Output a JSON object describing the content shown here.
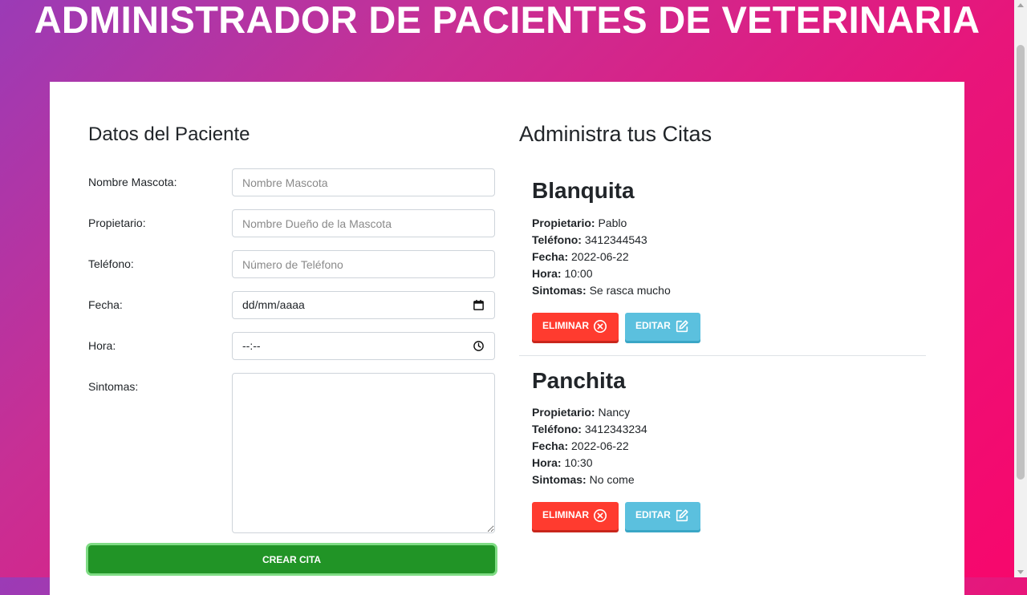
{
  "header": {
    "title": "ADMINISTRADOR DE PACIENTES DE VETERINARIA"
  },
  "form": {
    "title": "Datos del Paciente",
    "fields": [
      {
        "label": "Nombre Mascota:",
        "placeholder": "Nombre Mascota",
        "value": ""
      },
      {
        "label": "Propietario:",
        "placeholder": "Nombre Dueño de la Mascota",
        "value": ""
      },
      {
        "label": "Teléfono:",
        "placeholder": "Número de Teléfono",
        "value": ""
      },
      {
        "label": "Fecha:",
        "placeholder": "dd/mm/aaaa",
        "value": ""
      },
      {
        "label": "Hora:",
        "placeholder": "--:--",
        "value": ""
      },
      {
        "label": "Sintomas:",
        "placeholder": "",
        "value": ""
      }
    ],
    "submit_label": "CREAR CITA"
  },
  "appointments": {
    "title": "Administra tus Citas",
    "labels": {
      "owner": "Propietario:",
      "phone": "Teléfono:",
      "date": "Fecha:",
      "time": "Hora:",
      "symptoms": "Sintomas:"
    },
    "delete_label": "ELIMINAR",
    "edit_label": "EDITAR",
    "items": [
      {
        "pet": "Blanquita",
        "owner": "Pablo",
        "phone": "3412344543",
        "date": "2022-06-22",
        "time": "10:00",
        "symptoms": "Se rasca mucho"
      },
      {
        "pet": "Panchita",
        "owner": "Nancy",
        "phone": "3412343234",
        "date": "2022-06-22",
        "time": "10:30",
        "symptoms": "No come"
      }
    ]
  },
  "colors": {
    "delete": "#ff3b2f",
    "edit": "#5bc0de",
    "submit": "#219426"
  },
  "icons": {
    "delete": "x-circle-icon",
    "edit": "edit-icon",
    "date": "calendar-icon",
    "time": "clock-icon"
  }
}
